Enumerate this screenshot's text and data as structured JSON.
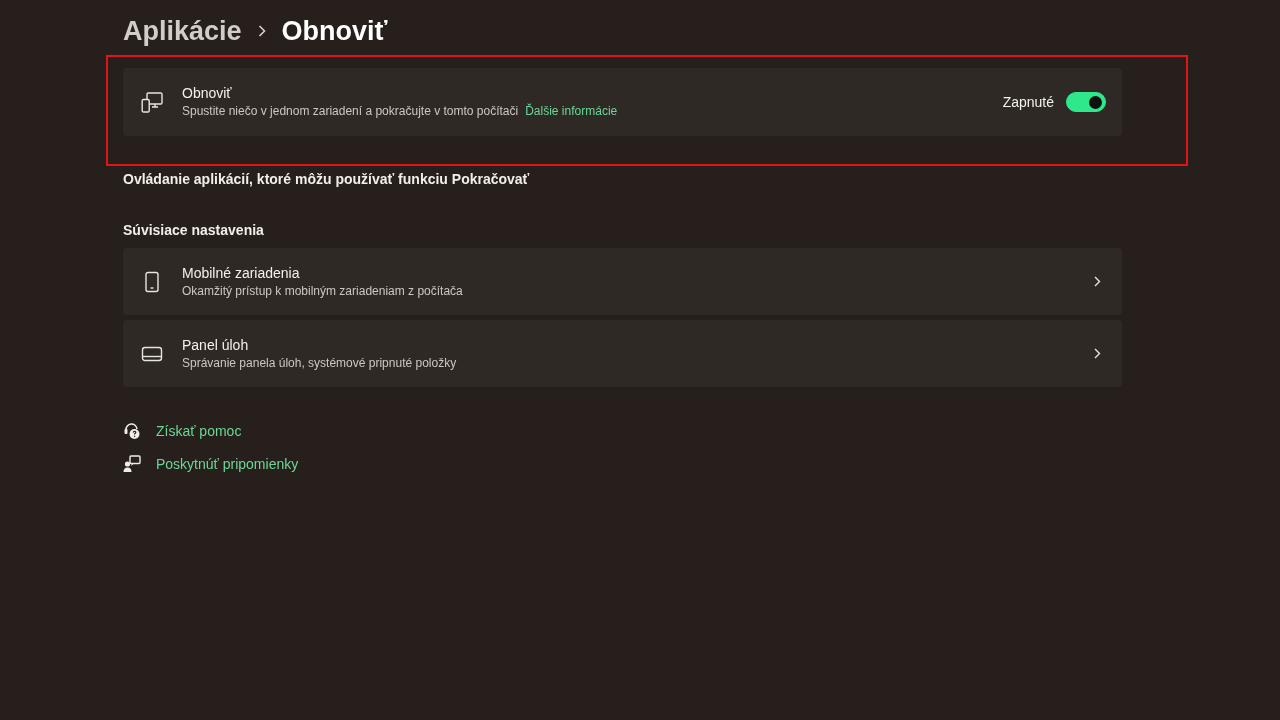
{
  "breadcrumb": {
    "parent": "Aplikácie",
    "current": "Obnoviť"
  },
  "main_setting": {
    "title": "Obnoviť",
    "description": "Spustite niečo v jednom zariadení a pokračujte v tomto počítači",
    "link": "Ďalšie informácie",
    "toggle_label": "Zapnuté",
    "on": true,
    "highlighted": true
  },
  "apps_heading": "Ovládanie aplikácií, ktoré môžu používať funkciu Pokračovať",
  "related": {
    "heading": "Súvisiace nastavenia",
    "items": [
      {
        "kind": "phone",
        "title": "Mobilné zariadenia",
        "description": "Okamžitý prístup k mobilným zariadeniam z počítača"
      },
      {
        "kind": "taskbar",
        "title": "Panel úloh",
        "description": "Správanie panela úloh, systémové pripnuté položky"
      }
    ]
  },
  "help_links": [
    {
      "kind": "help",
      "label": "Získať pomoc"
    },
    {
      "kind": "feedback",
      "label": "Poskytnúť pripomienky"
    }
  ]
}
